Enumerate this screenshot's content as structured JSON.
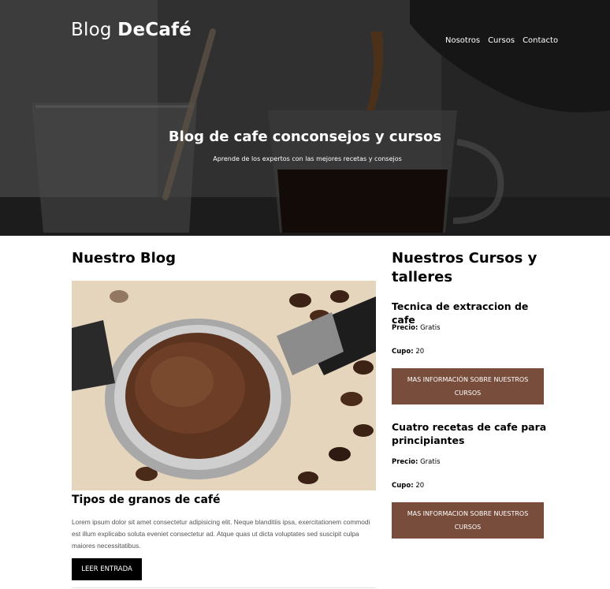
{
  "header": {
    "logo_prefix": "Blog",
    "logo_bold": "DeCafé",
    "nav": [
      "Nosotros",
      "Cursos",
      "Contacto"
    ],
    "title": "Blog de cafe conconsejos y cursos",
    "subtitle": "Aprende de los expertos con las mejores recetas y consejos"
  },
  "blog": {
    "heading": "Nuestro Blog",
    "post": {
      "title": "Tipos de granos de café",
      "excerpt": "Lorem ipsum dolor sit amet consectetur adipisicing elit. Neque blanditiis ipsa, exercitationem commodi est illum explicabo soluta eveniet consectetur ad. Atque quas ut dicta voluptates sed suscipit culpa maiores necessitatibus.",
      "button": "LEER ENTRADA"
    }
  },
  "courses": {
    "heading": "Nuestros Cursos y talleres",
    "items": [
      {
        "title": "Tecnica de extraccion de cafe",
        "price_label": "Precio:",
        "price": "Gratis",
        "cupo_label": "Cupo:",
        "cupo": "20",
        "button": "MAS INFORMACIÓN SOBRE NUESTROS CURSOS"
      },
      {
        "title": "Cuatro recetas de cafe para principiantes",
        "price_label": "Precio:",
        "price": "Gratis",
        "cupo_label": "Cupo:",
        "cupo": "20",
        "button": "MAS INFORMACION SOBRE NUESTROS CURSOS"
      }
    ]
  },
  "colors": {
    "course_button": "#784d3c",
    "read_button": "#000000"
  }
}
